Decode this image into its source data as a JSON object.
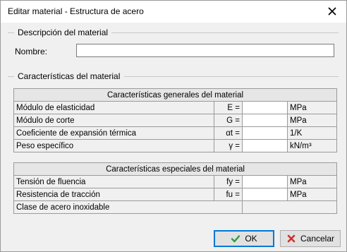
{
  "window": {
    "title": "Editar material - Estructura de acero",
    "close_icon": "close-icon"
  },
  "description_group": {
    "title": "Descripción del material",
    "name_label": "Nombre:",
    "name_value": ""
  },
  "characteristics_group": {
    "title": "Características del material"
  },
  "general_table": {
    "header": "Características generales del  material",
    "rows": [
      {
        "label": "Módulo de elasticidad",
        "symbol": "E =",
        "value": "",
        "unit": "MPa"
      },
      {
        "label": "Módulo de corte",
        "symbol": "G =",
        "value": "",
        "unit": "MPa"
      },
      {
        "label": "Coeficiente de expansión térmica",
        "symbol": "αt =",
        "value": "",
        "unit": "1/K"
      },
      {
        "label": "Peso específico",
        "symbol": "γ =",
        "value": "",
        "unit": "kN/m³"
      }
    ]
  },
  "special_table": {
    "header": "Características especiales del material",
    "rows": [
      {
        "label": "Tensión de fluencia",
        "symbol": "fy =",
        "value": "",
        "unit": "MPa"
      },
      {
        "label": "Resistencia de tracción",
        "symbol": "fu =",
        "value": "",
        "unit": "MPa"
      },
      {
        "label": "Clase de acero inoxidable",
        "value": ""
      }
    ]
  },
  "buttons": {
    "ok_label": "OK",
    "ok_icon": "check-icon",
    "cancel_label": "Cancelar",
    "cancel_icon": "x-icon"
  },
  "colors": {
    "accent": "#0078d7",
    "ok_check": "#2e9e3a",
    "cancel_x": "#d0312d"
  }
}
